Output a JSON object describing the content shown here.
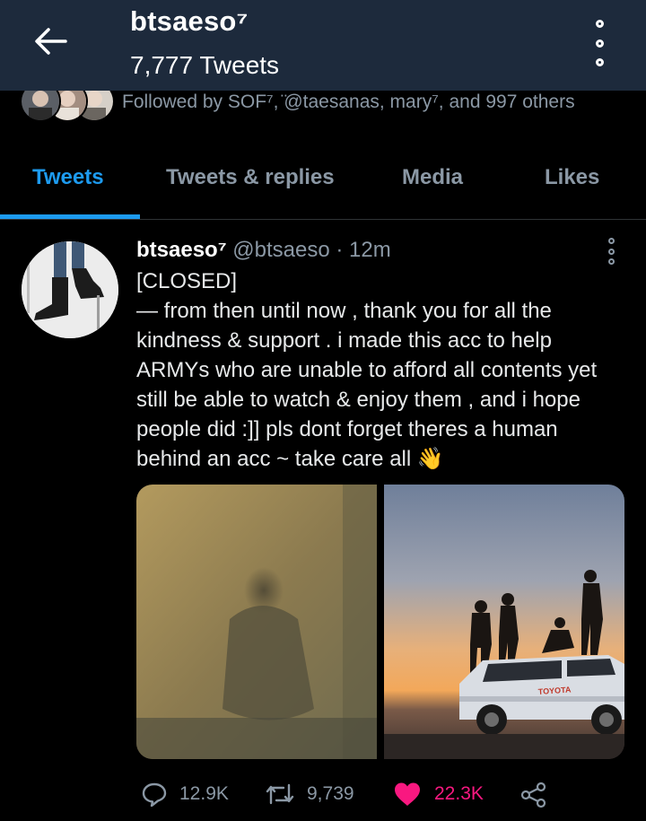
{
  "header": {
    "name": "btsaeso⁷",
    "tweet_count": "7,777 Tweets"
  },
  "followers": {
    "text": "Followed by SOF⁷, ̈@taesanas, mary⁷, and 997 others"
  },
  "tabs": [
    {
      "label": "Tweets",
      "active": true
    },
    {
      "label": "Tweets & replies",
      "active": false
    },
    {
      "label": "Media",
      "active": false
    },
    {
      "label": "Likes",
      "active": false
    }
  ],
  "tweet": {
    "name": "btsaeso⁷",
    "handle": "@btsaeso",
    "dot": "·",
    "time": "12m",
    "lines": [
      "[CLOSED]",
      "— from then until now , thank you for all the",
      "kindness & support . i made this acc to help",
      "ARMYs who are unable to afford all contents yet",
      "still be able to watch & enjoy them , and i hope",
      "people did :]] pls dont forget theres a human",
      "behind an acc ~ take care all 👋"
    ],
    "car_text": "TOYOTA",
    "stats": {
      "replies": "12.9K",
      "retweets": "9,739",
      "likes": "22.3K"
    }
  },
  "colors": {
    "header_bg": "#1d2a3c",
    "accent": "#1d9bf0",
    "like": "#f91880",
    "muted": "#8b98a5"
  }
}
